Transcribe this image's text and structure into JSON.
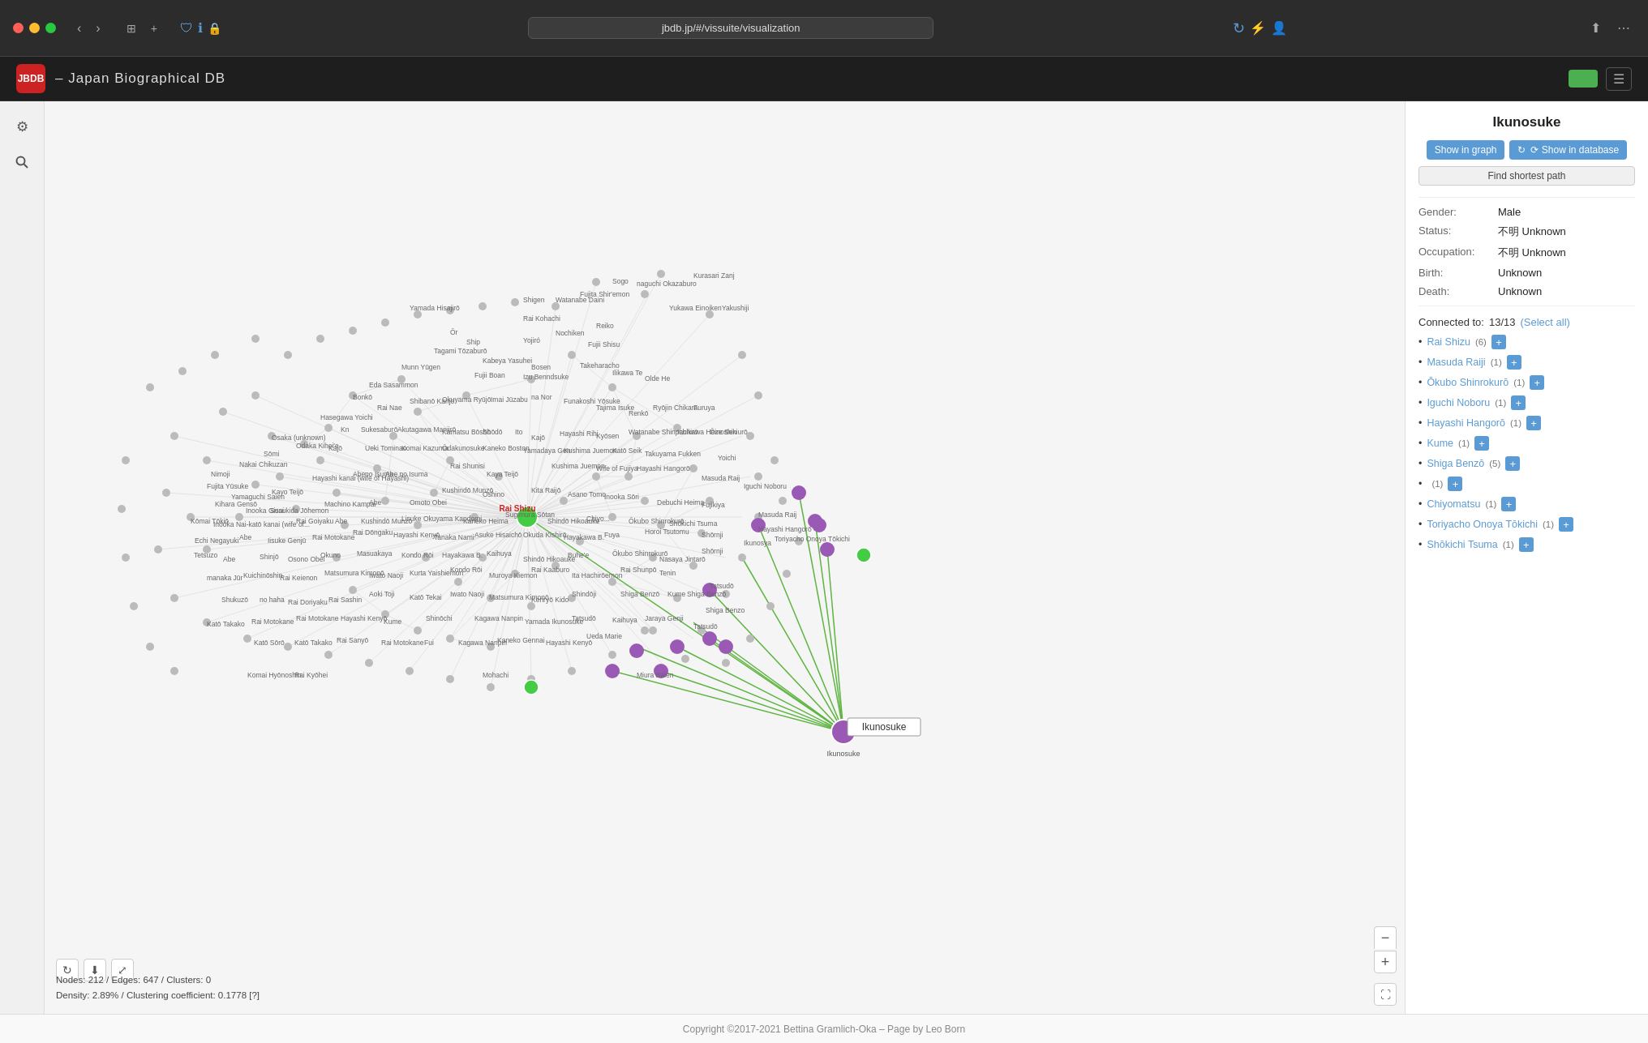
{
  "browser": {
    "url": "jbdb.jp/#/vissuite/visualization",
    "back_disabled": true,
    "forward_disabled": true
  },
  "app": {
    "logo_text": "JBDB",
    "title": "– Japan Biographical DB",
    "toggle_state": "on",
    "menu_icon": "☰"
  },
  "graph": {
    "stats_line1": "Nodes: 212 / Edges: 647 / Clusters: 0",
    "stats_line2": "Density: 2.89% / Clustering coefficient: 0.1778 [?]"
  },
  "panel": {
    "title": "Ikunosuke",
    "show_in_graph_label": "Show in graph",
    "show_in_database_label": "⟳ Show in database",
    "find_shortest_path_label": "Find shortest path",
    "gender_label": "Gender:",
    "gender_value": "Male",
    "status_label": "Status:",
    "status_value": "不明 Unknown",
    "occupation_label": "Occupation:",
    "occupation_value": "不明 Unknown",
    "birth_label": "Birth:",
    "birth_value": "Unknown",
    "death_label": "Death:",
    "death_value": "Unknown",
    "connected_label": "Connected to:",
    "connected_count": "13/13",
    "select_all_label": "(Select all)",
    "connections": [
      {
        "name": "Rai Shizu",
        "count": "(6)",
        "has_plus": true
      },
      {
        "name": "Masuda Raiji",
        "count": "(1)",
        "has_plus": true
      },
      {
        "name": "Ōkubo Shinrokurō",
        "count": "(1)",
        "has_plus": true
      },
      {
        "name": "Iguchi Noboru",
        "count": "(1)",
        "has_plus": true
      },
      {
        "name": "Hayashi Hangorō",
        "count": "(1)",
        "has_plus": true
      },
      {
        "name": "Kume",
        "count": "(1)",
        "has_plus": true
      },
      {
        "name": "Shiga Benzō",
        "count": "(5)",
        "has_plus": true
      },
      {
        "name": "",
        "count": "(1)",
        "has_plus": true
      },
      {
        "name": "Chiyomatsu",
        "count": "(1)",
        "has_plus": true
      },
      {
        "name": "Toriyacho Onoya Tōkichi",
        "count": "(1)",
        "has_plus": true
      },
      {
        "name": "Shōkichi Tsuma",
        "count": "(1)",
        "has_plus": true
      }
    ]
  },
  "footer": {
    "text": "Copyright ©2017-2021 Bettina Gramlich-Oka – Page by Leo Born"
  },
  "sidebar": {
    "settings_icon": "⚙",
    "search_icon": "🔍"
  }
}
